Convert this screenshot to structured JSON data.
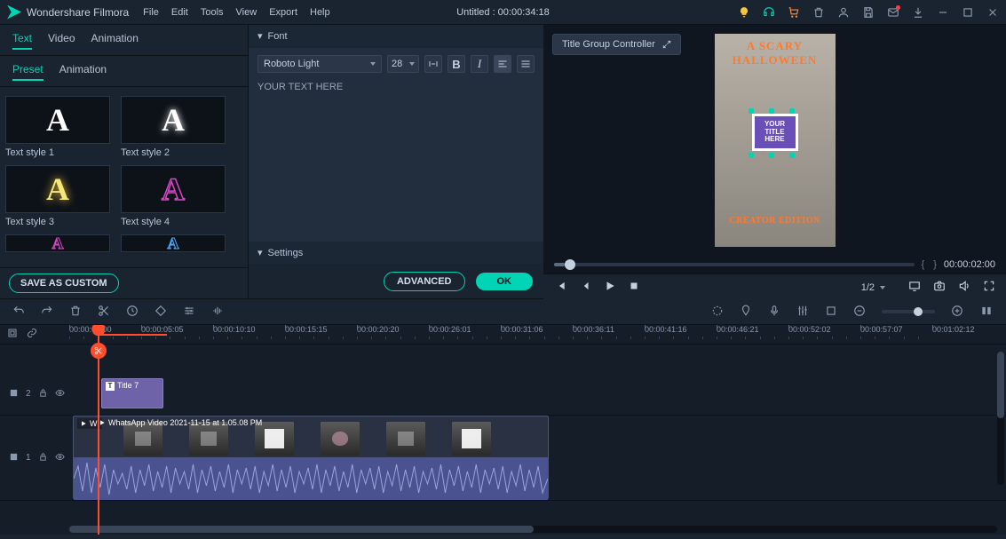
{
  "app": {
    "name": "Wondershare Filmora",
    "doc_title": "Untitled : 00:00:34:18"
  },
  "menu": [
    "File",
    "Edit",
    "Tools",
    "View",
    "Export",
    "Help"
  ],
  "tabs1": {
    "items": [
      "Text",
      "Video",
      "Animation"
    ],
    "active": "Text"
  },
  "tabs2": {
    "items": [
      "Preset",
      "Animation"
    ],
    "active": "Preset"
  },
  "styles": [
    {
      "label": "Text style 1"
    },
    {
      "label": "Text style 2"
    },
    {
      "label": "Text style 3"
    },
    {
      "label": "Text style 4"
    }
  ],
  "buttons": {
    "save_custom": "SAVE AS CUSTOM",
    "advanced": "ADVANCED",
    "ok": "OK"
  },
  "font_panel": {
    "section_font": "Font",
    "section_settings": "Settings",
    "font_name": "Roboto Light",
    "font_size": "28",
    "placeholder": "YOUR TEXT HERE"
  },
  "title_group": "Title Group Controller",
  "preview": {
    "line1": "A SCARY",
    "line2": "HALLOWEEN",
    "box_l1": "YOUR",
    "box_l2": "TITLE",
    "box_l3": "HERE",
    "creator": "CREATOR EDITION"
  },
  "scrub": {
    "bracket_l": "{",
    "bracket_r": "}",
    "time": "00:00:02:00"
  },
  "transport": {
    "zoom": "1/2"
  },
  "ruler": [
    "00:00:00:00",
    "00:00:05:05",
    "00:00:10:10",
    "00:00:15:15",
    "00:00:20:20",
    "00:00:26:01",
    "00:00:31:06",
    "00:00:36:11",
    "00:00:41:16",
    "00:00:46:21",
    "00:00:52:02",
    "00:00:57:07",
    "00:01:02:12"
  ],
  "tracks": {
    "t2": "2",
    "t1": "1",
    "title_clip": "Title 7",
    "vid_label_short": "WI",
    "vid_label": "WhatsApp Video 2021-11-15 at 1.05.08 PM"
  }
}
